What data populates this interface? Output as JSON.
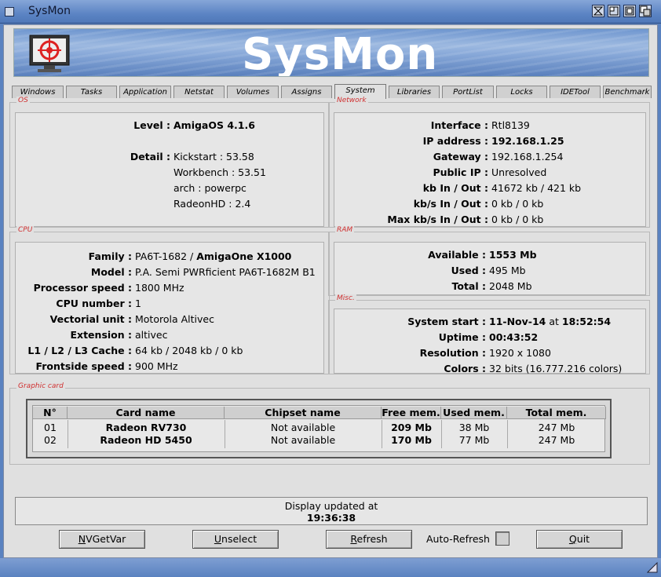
{
  "window": {
    "title": "SysMon",
    "banner_text": "SysMon"
  },
  "tabs": [
    "Windows",
    "Tasks",
    "Application",
    "Netstat",
    "Volumes",
    "Assigns",
    "System",
    "Libraries",
    "PortList",
    "Locks",
    "IDETool",
    "Benchmark"
  ],
  "active_tab": "System",
  "os": {
    "legend": "OS",
    "level_label": "Level :",
    "level_value": "AmigaOS 4.1.6",
    "detail_label": "Detail :",
    "details": [
      "Kickstart : 53.58",
      "Workbench : 53.51",
      "arch : powerpc",
      "RadeonHD : 2.4"
    ]
  },
  "network": {
    "legend": "Network",
    "rows": [
      {
        "label": "Interface :",
        "value": "Rtl8139",
        "bold": false
      },
      {
        "label": "IP address :",
        "value": "192.168.1.25",
        "bold": true
      },
      {
        "label": "Gateway :",
        "value": "192.168.1.254",
        "bold": false
      },
      {
        "label": "Public IP :",
        "value": "Unresolved",
        "bold": false
      },
      {
        "label": "kb In / Out :",
        "value": "41672 kb / 421 kb",
        "bold": false
      },
      {
        "label": "kb/s In / Out :",
        "value": "0 kb / 0 kb",
        "bold": false
      },
      {
        "label": "Max kb/s In / Out :",
        "value": "0 kb / 0 kb",
        "bold": false
      }
    ]
  },
  "cpu": {
    "legend": "CPU",
    "family_label": "Family :",
    "family_value": "PA6T-1682 / ",
    "family_value_bold": "AmigaOne X1000",
    "rows": [
      {
        "label": "Model :",
        "value": "P.A. Semi PWRficient PA6T-1682M B1"
      },
      {
        "label": "Processor speed :",
        "value": "1800 MHz"
      },
      {
        "label": "CPU number :",
        "value": "1"
      },
      {
        "label": "Vectorial unit :",
        "value": "Motorola Altivec"
      },
      {
        "label": "Extension :",
        "value": "altivec"
      },
      {
        "label": "L1 / L2 / L3 Cache :",
        "value": "64 kb / 2048 kb / 0 kb"
      },
      {
        "label": "Frontside speed :",
        "value": "900 MHz"
      }
    ]
  },
  "ram": {
    "legend": "RAM",
    "rows": [
      {
        "label": "Available :",
        "value": "1553 Mb",
        "bold": true
      },
      {
        "label": "Used :",
        "value": "495 Mb",
        "bold": false
      },
      {
        "label": "Total :",
        "value": "2048 Mb",
        "bold": false
      }
    ]
  },
  "misc": {
    "legend": "Misc.",
    "start_label": "System start :",
    "start_date": "11-Nov-14",
    "start_at": " at ",
    "start_time": "18:52:54",
    "uptime_label": "Uptime :",
    "uptime_value": "00:43:52",
    "resolution_label": "Resolution :",
    "resolution_value": "1920 x 1080",
    "colors_label": "Colors :",
    "colors_value": "32 bits (16.777.216 colors)"
  },
  "graphic": {
    "legend": "Graphic card",
    "headers": [
      "N°",
      "Card name",
      "Chipset name",
      "Free mem.",
      "Used mem.",
      "Total mem."
    ],
    "rows": [
      [
        "01",
        "Radeon RV730",
        "Not available",
        "209 Mb",
        "38 Mb",
        "247 Mb"
      ],
      [
        "02",
        "Radeon HD 5450",
        "Not available",
        "170 Mb",
        "77 Mb",
        "247 Mb"
      ]
    ]
  },
  "status": {
    "line1": "Display updated at",
    "time": "19:36:38"
  },
  "buttons": {
    "nvgetvar_u": "N",
    "nvgetvar_rest": "VGetVar",
    "unselect_u": "U",
    "unselect_rest": "nselect",
    "refresh_u": "R",
    "refresh_rest": "efresh",
    "autorefresh_label": "Auto-Refresh",
    "quit_u": "Q",
    "quit_rest": "uit"
  }
}
